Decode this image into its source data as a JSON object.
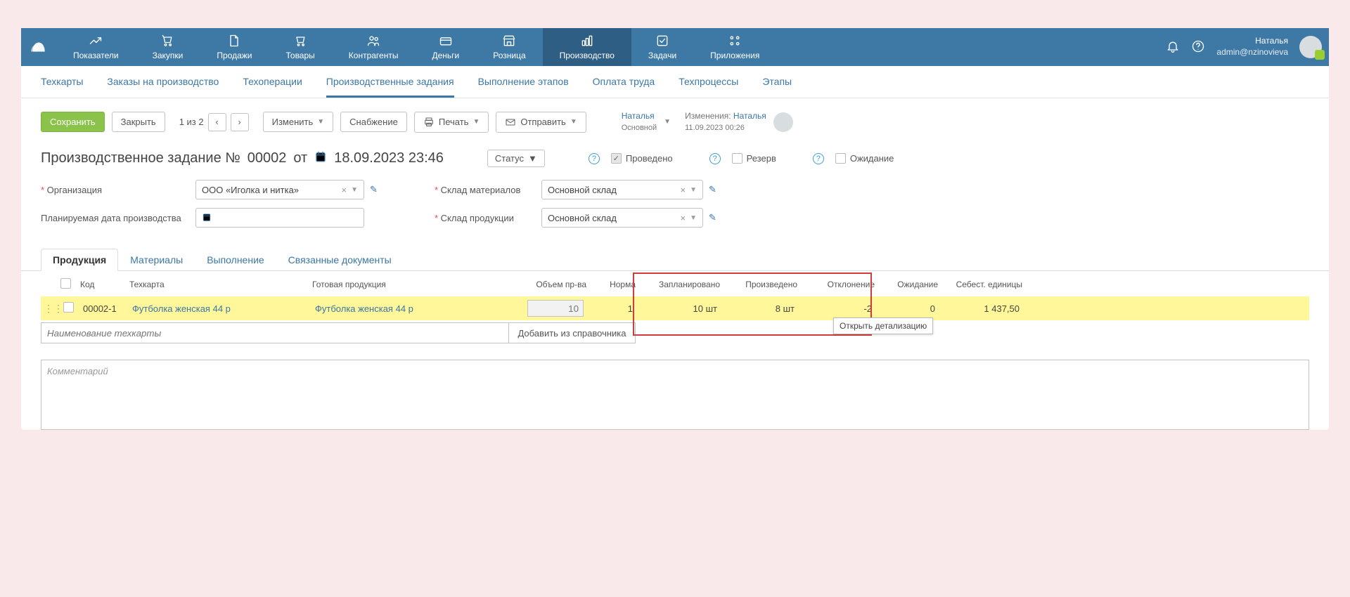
{
  "topnav": {
    "items": [
      {
        "label": "Показатели"
      },
      {
        "label": "Закупки"
      },
      {
        "label": "Продажи"
      },
      {
        "label": "Товары"
      },
      {
        "label": "Контрагенты"
      },
      {
        "label": "Деньги"
      },
      {
        "label": "Розница"
      },
      {
        "label": "Производство",
        "active": true
      },
      {
        "label": "Задачи"
      },
      {
        "label": "Приложения"
      }
    ],
    "user": {
      "name": "Наталья",
      "login": "admin@nzinovieva"
    }
  },
  "subnav": {
    "items": [
      {
        "label": "Техкарты"
      },
      {
        "label": "Заказы на производство"
      },
      {
        "label": "Техоперации"
      },
      {
        "label": "Производственные задания",
        "active": true
      },
      {
        "label": "Выполнение этапов"
      },
      {
        "label": "Оплата труда"
      },
      {
        "label": "Техпроцессы"
      },
      {
        "label": "Этапы"
      }
    ]
  },
  "toolbar": {
    "save": "Сохранить",
    "close": "Закрыть",
    "pager": "1 из 2",
    "edit": "Изменить",
    "supply": "Снабжение",
    "print": "Печать",
    "send": "Отправить",
    "owner": {
      "name": "Наталья",
      "sub": "Основной"
    },
    "changes": {
      "prefix": "Изменения:",
      "name": "Наталья",
      "ts": "11.09.2023 00:26"
    }
  },
  "doc": {
    "title_prefix": "Производственное задание №",
    "number": "00002",
    "from": "от",
    "datetime": "18.09.2023 23:46",
    "status_label": "Статус",
    "flags": {
      "posted": "Проведено",
      "reserve": "Резерв",
      "waiting": "Ожидание"
    },
    "fields": {
      "org_label": "Организация",
      "org_value": "ООО «Иголка и нитка»",
      "plan_date_label": "Планируемая дата производства",
      "mat_store_label": "Склад материалов",
      "mat_store_value": "Основной склад",
      "prod_store_label": "Склад продукции",
      "prod_store_value": "Основной склад"
    }
  },
  "tabs": [
    {
      "label": "Продукция",
      "active": true
    },
    {
      "label": "Материалы"
    },
    {
      "label": "Выполнение"
    },
    {
      "label": "Связанные документы"
    }
  ],
  "table": {
    "headers": {
      "code": "Код",
      "techcard": "Техкарта",
      "product": "Готовая продукция",
      "volume": "Объем пр-ва",
      "norm": "Норма",
      "planned": "Запланировано",
      "produced": "Произведено",
      "deviation": "Отклонение",
      "waiting": "Ожидание",
      "unit_cost": "Себест. единицы"
    },
    "rows": [
      {
        "code": "00002-1",
        "techcard": "Футболка женская 44 р",
        "product": "Футболка женская 44 р",
        "volume": "10",
        "norm": "1",
        "planned": "10 шт",
        "produced": "8 шт",
        "deviation": "-2",
        "waiting": "0",
        "unit_cost": "1 437,50"
      }
    ],
    "placeholder": "Наименование техкарты",
    "add_btn": "Добавить из справочника",
    "tooltip": "Открыть детализацию"
  },
  "comment_placeholder": "Комментарий"
}
